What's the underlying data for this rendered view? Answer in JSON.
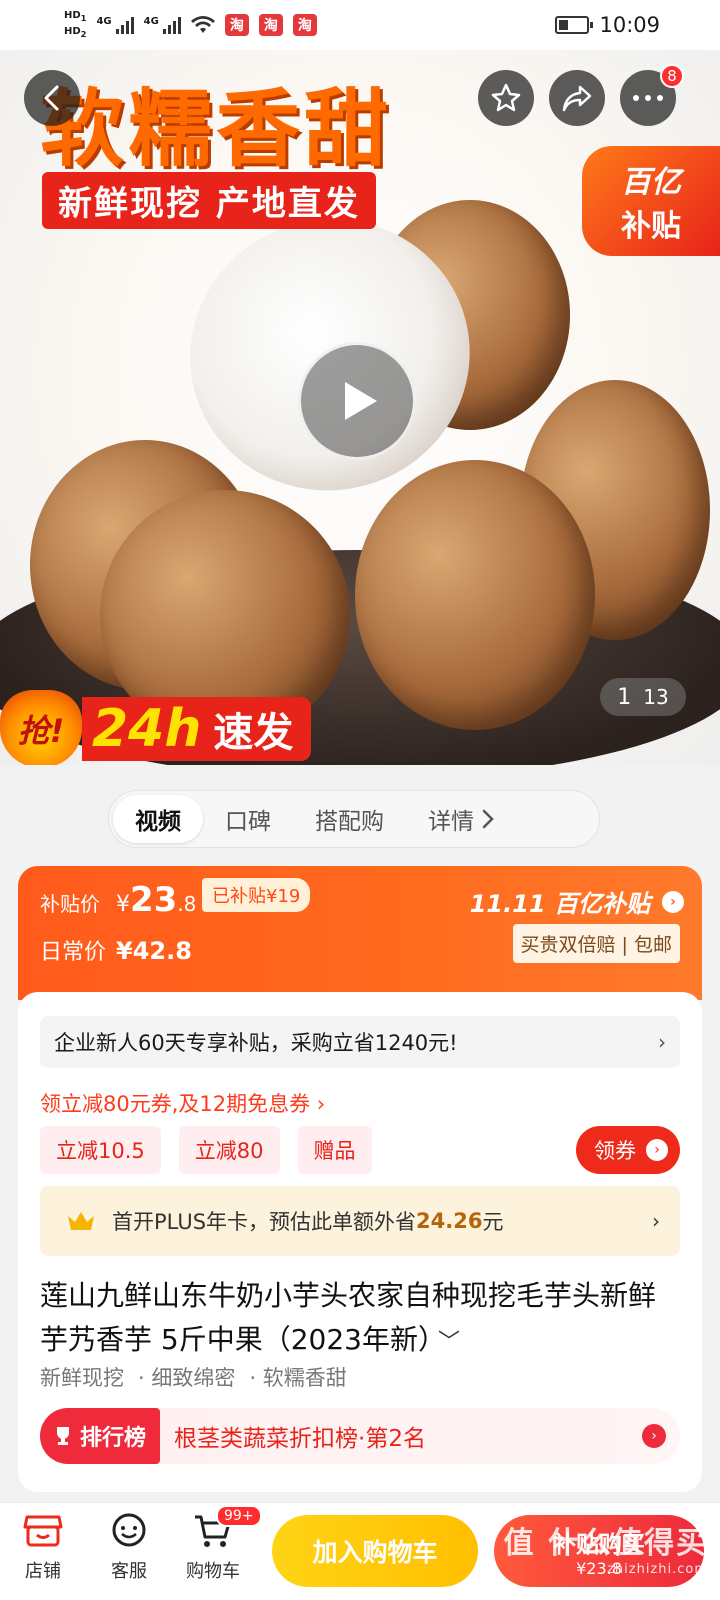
{
  "status_bar": {
    "hd1": "HD",
    "hd1_sub": "1",
    "hd2": "HD",
    "hd2_sub": "2",
    "sim1": "4G",
    "sim2": "4G",
    "app_badges": [
      "淘",
      "淘",
      "淘"
    ],
    "time": "10:09"
  },
  "hero": {
    "title": "软糯香甜",
    "subtitle": "新鲜现挖 产地直发",
    "promo_grab": "抢!",
    "promo_24h": "24h",
    "promo_speed": "速发",
    "subsidy_line1": "百亿",
    "subsidy_line2": "补贴",
    "image_index": "1",
    "image_total": "13",
    "more_badge": "8"
  },
  "tabs": [
    "视频",
    "口碑",
    "搭配购",
    "详情"
  ],
  "price": {
    "subsidy_label": "补贴价",
    "currency": "¥",
    "price_int": "23",
    "price_dec": ".8",
    "subsidized": "已补贴¥19",
    "daily_label": "日常价",
    "daily_price": "¥42.8",
    "brand": "11.11 百亿补贴",
    "guarantee": "买贵双倍赔 | 包邮"
  },
  "offers": {
    "enterprise": "企业新人60天专享补贴，采购立省1240元!",
    "coupon_line": "领立减80元券,及12期免息券 ›",
    "chips": [
      "立减10.5",
      "立减80",
      "赠品"
    ],
    "get_coupon": "领券",
    "plus_prefix": "首开PLUS年卡，预估此单额外省",
    "plus_amount": "24.26",
    "plus_suffix": "元"
  },
  "product": {
    "title": "莲山九鲜山东牛奶小芋头农家自种现挖毛芋头新鲜芋艿香芋 5斤中果（2023年新）",
    "tags": [
      "新鲜现挖",
      "· 细致绵密",
      "· 软糯香甜"
    ],
    "rank_badge": "排行榜",
    "rank_text": "根茎类蔬菜折扣榜·第2名"
  },
  "bottom_bar": {
    "store": "店铺",
    "service": "客服",
    "cart": "购物车",
    "cart_badge": "99+",
    "add_to_cart": "加入购物车",
    "buy": "补贴购买",
    "buy_price": "¥23.8"
  },
  "watermark": {
    "main": "值 什么值得买",
    "url": "zhizhizhi.com"
  },
  "colors": {
    "brand_orange": "#ff5a1c",
    "red": "#e8231a",
    "yellow_button": "#ffc600"
  }
}
